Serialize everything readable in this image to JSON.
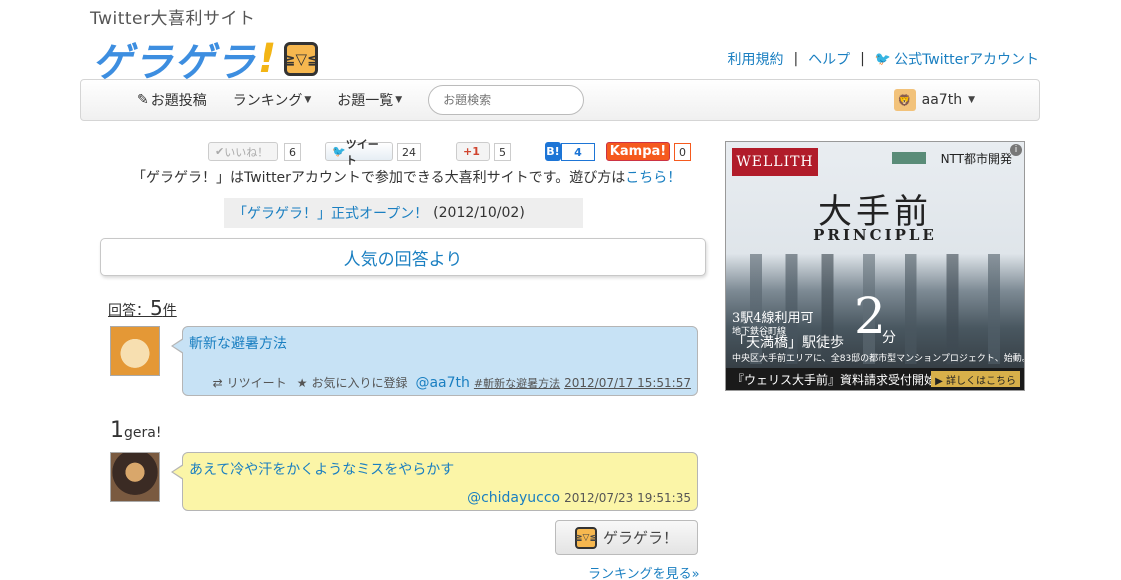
{
  "header": {
    "subtitle": "Twitter大喜利サイト",
    "logo_text": "ゲラゲラ",
    "logo_bang": "!",
    "links": {
      "terms": "利用規約",
      "sep1": "|",
      "help": "ヘルプ",
      "sep2": "|",
      "official": "公式Twitterアカウント"
    }
  },
  "nav": {
    "post": "お題投稿",
    "ranking": "ランキング",
    "topics": "お題一覧",
    "search_placeholder": "お題検索",
    "user": "aa7th"
  },
  "social": {
    "like_label": "いいね！",
    "like_count": "6",
    "tweet_label": "ツイート",
    "tweet_count": "24",
    "gplus_label": "+1",
    "gplus_count": "5",
    "hatena_label": "B!",
    "hatena_count": "4",
    "kampa_label": "Kampa!",
    "kampa_count": "0"
  },
  "intro": {
    "text": "「ゲラゲラ！」はTwitterアカウントで参加できる大喜利サイトです。遊び方は",
    "link": "こちら！"
  },
  "news": {
    "link": "「ゲラゲラ！」正式オープン！",
    "date": "(2012/10/02)"
  },
  "section_title": "人気の回答より",
  "answers": {
    "label": "回答：",
    "count": "5",
    "unit": "件"
  },
  "post1": {
    "topic": "斬新な避暑方法",
    "retweet": "リツイート",
    "favorite": "お気に入りに登録",
    "user": "@aa7th",
    "tag": "#斬新な避暑方法",
    "timestamp": "2012/07/17 15:51:57"
  },
  "gera": {
    "count": "1",
    "unit": "gera!"
  },
  "post2": {
    "topic": "あえて冷や汗をかくようなミスをやらかす",
    "user": "@chidayucco",
    "timestamp": "2012/07/23 19:51:35"
  },
  "gera_button": "ゲラゲラ！",
  "ranking_link": "ランキングを見る»",
  "ad": {
    "brand": "WELLITH",
    "corp": "NTT都市開発",
    "title": "大手前",
    "subtitle": "PRINCIPLE",
    "line1": "3駅4線利用可",
    "line2": "地下鉄谷町線",
    "line3": "「天満橋」駅徒歩",
    "two": "2",
    "fun": "分",
    "line4": "中央区大手前エリアに、全83邸の都市型マンションプロジェクト、始動。",
    "bar": "『ウェリス大手前』資料請求受付開始",
    "bar_btn": "▶ 詳しくはこちら"
  }
}
